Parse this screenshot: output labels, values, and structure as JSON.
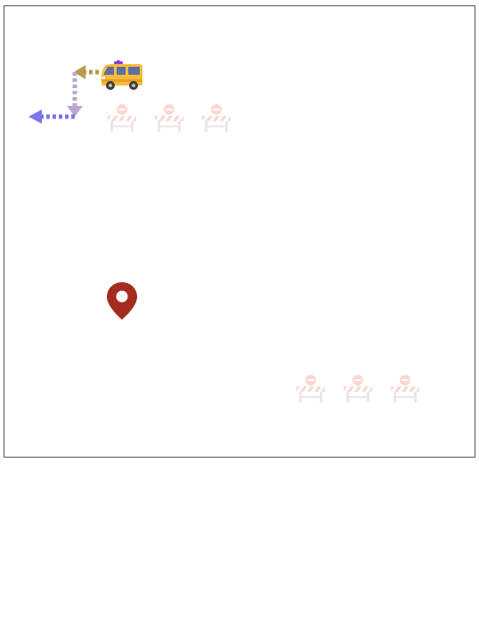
{
  "scene": {
    "board": {
      "border_color": "#555555",
      "background": "#ffffff"
    },
    "van": {
      "icon": "yellow-van-icon",
      "color": "#f5bb3a"
    },
    "path": {
      "segments": [
        {
          "direction": "left",
          "color": "#b89a4a"
        },
        {
          "direction": "down",
          "color": "#bba6cf"
        },
        {
          "direction": "left",
          "color": "#7f74ee"
        }
      ]
    },
    "goal": {
      "icon": "map-pin-icon",
      "color": "#a52b1f"
    },
    "barrier_groups": [
      {
        "count": 3,
        "icon": "road-barrier-icon",
        "color": "#f2a397"
      },
      {
        "count": 3,
        "icon": "road-barrier-icon",
        "color": "#f2a397"
      }
    ]
  }
}
